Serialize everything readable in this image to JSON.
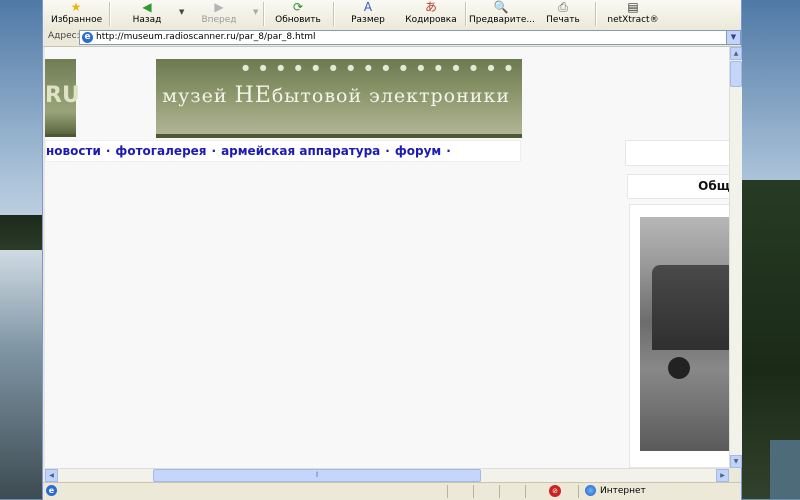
{
  "toolbar": {
    "favorites": "Избранное",
    "back": "Назад",
    "forward": "Вперед",
    "refresh": "Обновить",
    "size": "Размер",
    "encoding": "Кодировка",
    "preview": "Предварите...",
    "print": "Печать",
    "netxtract": "netXtract®"
  },
  "address": {
    "label": "Адрес:",
    "url": "http://museum.radioscanner.ru/par_8/par_8.html"
  },
  "page": {
    "logo_text": "RU",
    "banner_dots": "● ● ● ● ● ● ● ● ● ● ● ● ● ● ● ●",
    "banner_title_part1": "музей ",
    "banner_title_big": "НЕ",
    "banner_title_part2": "бытовой электроники",
    "nav": {
      "news": "новости",
      "gallery": "фотогалерея",
      "army": "армейская аппаратура",
      "forum": "форум",
      "separator": "·"
    },
    "right_heading": "Общ"
  },
  "status": {
    "zone": "Интернет"
  }
}
